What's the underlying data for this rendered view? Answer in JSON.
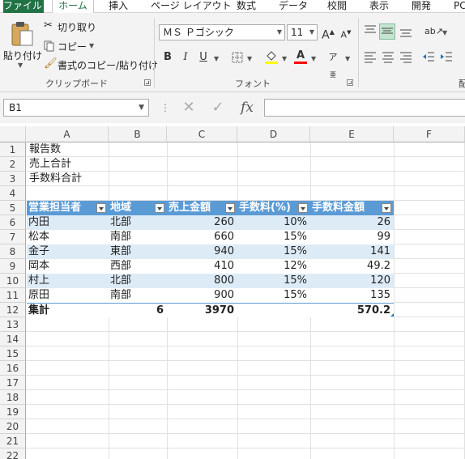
{
  "ribbon_tabs": [
    "ファイル",
    "ホーム",
    "挿入",
    "ページ レイアウト",
    "数式",
    "データ",
    "校閲",
    "表示",
    "開発",
    "PC"
  ],
  "active_tab": "ホーム",
  "clipboard": {
    "paste_label": "貼り付け",
    "cut_label": "切り取り",
    "copy_label": "コピー",
    "format_painter_label": "書式のコピー/貼り付け",
    "group_label": "クリップボード"
  },
  "font": {
    "font_name": "ＭＳ Ｐゴシック",
    "font_size": "11",
    "group_label": "フォント",
    "bold": "B",
    "italic": "I",
    "underline": "U",
    "grow": "A",
    "shrink": "A",
    "font_color_letter": "A"
  },
  "alignment": {
    "group_label": "配"
  },
  "formula_bar": {
    "name_box": "B1",
    "formula": "",
    "fx": "fx"
  },
  "columns": [
    "A",
    "B",
    "C",
    "D",
    "E",
    "F"
  ],
  "rows": [
    "1",
    "2",
    "3",
    "4",
    "5",
    "6",
    "7",
    "8",
    "9",
    "10",
    "11",
    "12",
    "13",
    "14",
    "15",
    "16",
    "17",
    "18",
    "19",
    "20",
    "21",
    "22"
  ],
  "sheet": {
    "labels": [
      "報告数",
      "売上合計",
      "手数料合計"
    ],
    "table_headers": [
      "営業担当者",
      "地域",
      "売上金額",
      "手数料(%)",
      "手数料金額"
    ],
    "table_rows": [
      [
        "内田",
        "北部",
        "260",
        "10%",
        "26"
      ],
      [
        "松本",
        "南部",
        "660",
        "15%",
        "99"
      ],
      [
        "金子",
        "東部",
        "940",
        "15%",
        "141"
      ],
      [
        "岡本",
        "西部",
        "410",
        "12%",
        "49.2"
      ],
      [
        "村上",
        "北部",
        "800",
        "15%",
        "120"
      ],
      [
        "原田",
        "南部",
        "900",
        "15%",
        "135"
      ]
    ],
    "total_row": [
      "集計",
      "6",
      "3970",
      "",
      "570.2"
    ]
  },
  "colors": {
    "ribbon_green": "#217346",
    "table_header_blue": "#5b9bd5",
    "table_band_blue": "#ddebf7"
  }
}
